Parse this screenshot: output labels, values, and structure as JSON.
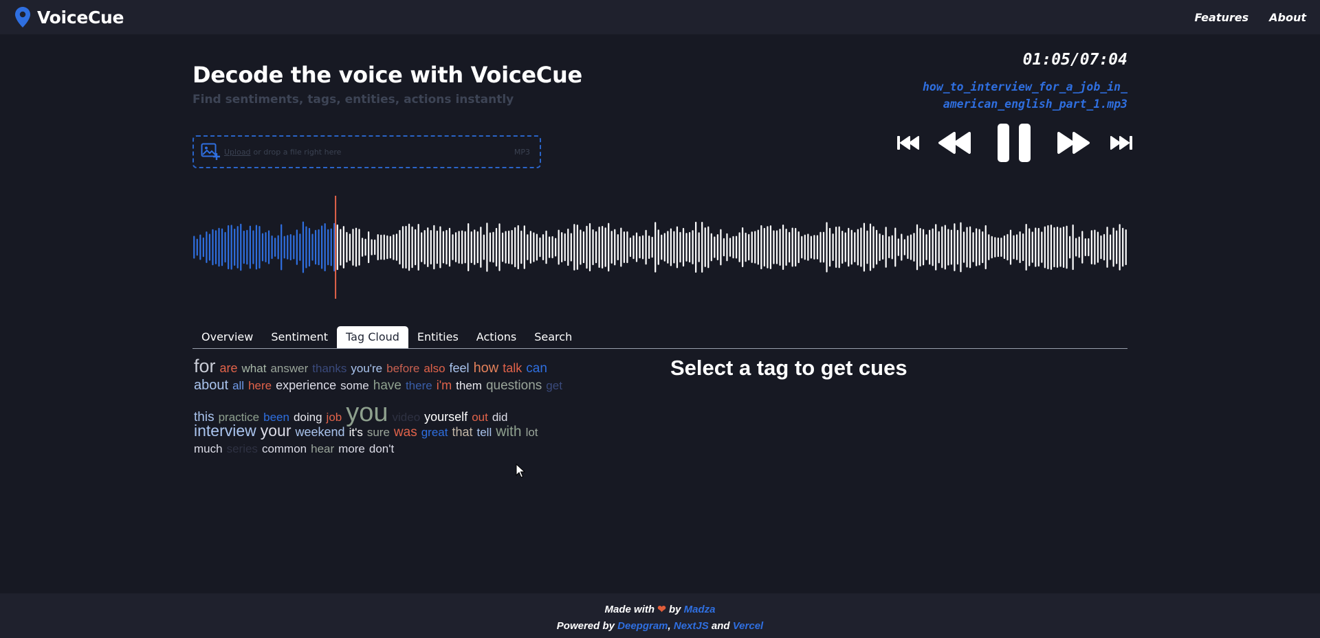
{
  "nav": {
    "brand": "VoiceCue",
    "links": [
      "Features",
      "About"
    ]
  },
  "header": {
    "title": "Decode the voice with VoiceCue",
    "subtitle": "Find sentiments, tags, entities, actions instantly"
  },
  "upload": {
    "link_label": "Upload",
    "rest_label": "or drop a file right here",
    "ext_label": "MP3"
  },
  "player": {
    "time": "01:05/07:04",
    "filename_line1": "how_to_interview_for_a_job_in_",
    "filename_line2": "american_english_part_1.mp3",
    "progress_fraction": 0.153,
    "controls": [
      "skip-back",
      "rewind",
      "pause",
      "fast-forward",
      "skip-forward"
    ]
  },
  "tabs": [
    {
      "label": "Overview",
      "active": false
    },
    {
      "label": "Sentiment",
      "active": false
    },
    {
      "label": "Tag Cloud",
      "active": true
    },
    {
      "label": "Entities",
      "active": false
    },
    {
      "label": "Actions",
      "active": false
    },
    {
      "label": "Search",
      "active": false
    }
  ],
  "tag_cloud": [
    [
      {
        "text": "for",
        "size": 27,
        "color": "#c9ccd6"
      },
      {
        "text": "are",
        "size": 18,
        "color": "#e2634a"
      },
      {
        "text": "what",
        "size": 17,
        "color": "#a8b8a8"
      },
      {
        "text": "answer",
        "size": 17,
        "color": "#9aa59a"
      },
      {
        "text": "thanks",
        "size": 17,
        "color": "#3a4a7c"
      },
      {
        "text": "you're",
        "size": 17,
        "color": "#aac4ee"
      },
      {
        "text": "before",
        "size": 17,
        "color": "#c86050"
      },
      {
        "text": "also",
        "size": 17,
        "color": "#e2634a"
      },
      {
        "text": "feel",
        "size": 18,
        "color": "#aac4ee"
      },
      {
        "text": "how",
        "size": 20,
        "color": "#e2805a"
      },
      {
        "text": "talk",
        "size": 18,
        "color": "#e2634a"
      },
      {
        "text": "can",
        "size": 19,
        "color": "#2f6fe0"
      }
    ],
    [
      {
        "text": "about",
        "size": 20,
        "color": "#aac4ee"
      },
      {
        "text": "all",
        "size": 17,
        "color": "#6f9ae8"
      },
      {
        "text": "here",
        "size": 17,
        "color": "#e2634a"
      },
      {
        "text": "experience",
        "size": 18,
        "color": "#dddde8"
      },
      {
        "text": "some",
        "size": 17,
        "color": "#dddde8"
      },
      {
        "text": "have",
        "size": 19,
        "color": "#8ea08e"
      },
      {
        "text": "there",
        "size": 17,
        "color": "#3a5ea8"
      },
      {
        "text": "i'm",
        "size": 18,
        "color": "#e2634a"
      },
      {
        "text": "them",
        "size": 17,
        "color": "#e8e8ee"
      },
      {
        "text": "questions",
        "size": 19,
        "color": "#9aa59a"
      },
      {
        "text": "get",
        "size": 17,
        "color": "#3a4a7c"
      }
    ],
    [
      {
        "text": "this",
        "size": 19,
        "color": "#aac4ee"
      },
      {
        "text": "practice",
        "size": 17,
        "color": "#8ea08e"
      },
      {
        "text": "been",
        "size": 17,
        "color": "#2f6fe0"
      },
      {
        "text": "doing",
        "size": 17,
        "color": "#e8e8ee"
      },
      {
        "text": "job",
        "size": 17,
        "color": "#e2634a"
      },
      {
        "text": "you",
        "size": 38,
        "color": "#8ea08e"
      },
      {
        "text": "video",
        "size": 17,
        "color": "#2e3142"
      },
      {
        "text": "yourself",
        "size": 18,
        "color": "#ffffff"
      },
      {
        "text": "out",
        "size": 17,
        "color": "#e2634a"
      },
      {
        "text": "did",
        "size": 17,
        "color": "#dddde8"
      }
    ],
    [
      {
        "text": "interview",
        "size": 23,
        "color": "#aac4ee"
      },
      {
        "text": "your",
        "size": 23,
        "color": "#dddde8"
      },
      {
        "text": "weekend",
        "size": 18,
        "color": "#aac4ee"
      },
      {
        "text": "it's",
        "size": 17,
        "color": "#ffffff"
      },
      {
        "text": "sure",
        "size": 17,
        "color": "#9aa59a"
      },
      {
        "text": "was",
        "size": 19,
        "color": "#e2634a"
      },
      {
        "text": "great",
        "size": 17,
        "color": "#2f6fe0"
      },
      {
        "text": "that",
        "size": 18,
        "color": "#c4b8a8"
      },
      {
        "text": "tell",
        "size": 17,
        "color": "#aac4ee"
      },
      {
        "text": "with",
        "size": 21,
        "color": "#8ea08e"
      },
      {
        "text": "lot",
        "size": 17,
        "color": "#9aa59a"
      }
    ],
    [
      {
        "text": "much",
        "size": 17,
        "color": "#dddde8"
      },
      {
        "text": "series",
        "size": 17,
        "color": "#2e3142"
      },
      {
        "text": "common",
        "size": 17,
        "color": "#dddde8"
      },
      {
        "text": "hear",
        "size": 17,
        "color": "#9aa59a"
      },
      {
        "text": "more",
        "size": 17,
        "color": "#dddde8"
      },
      {
        "text": "don't",
        "size": 17,
        "color": "#dddde8"
      }
    ]
  ],
  "cues": {
    "title": "Select a tag to get cues"
  },
  "footer": {
    "made_with": "Made with",
    "by": "by",
    "author": "Madza",
    "powered_by": "Powered by",
    "tech1": "Deepgram",
    "tech2": "NextJS",
    "and": "and",
    "tech3": "Vercel"
  },
  "colors": {
    "accent": "#2f6fe0",
    "playhead": "#e2634a",
    "background": "#171923"
  }
}
